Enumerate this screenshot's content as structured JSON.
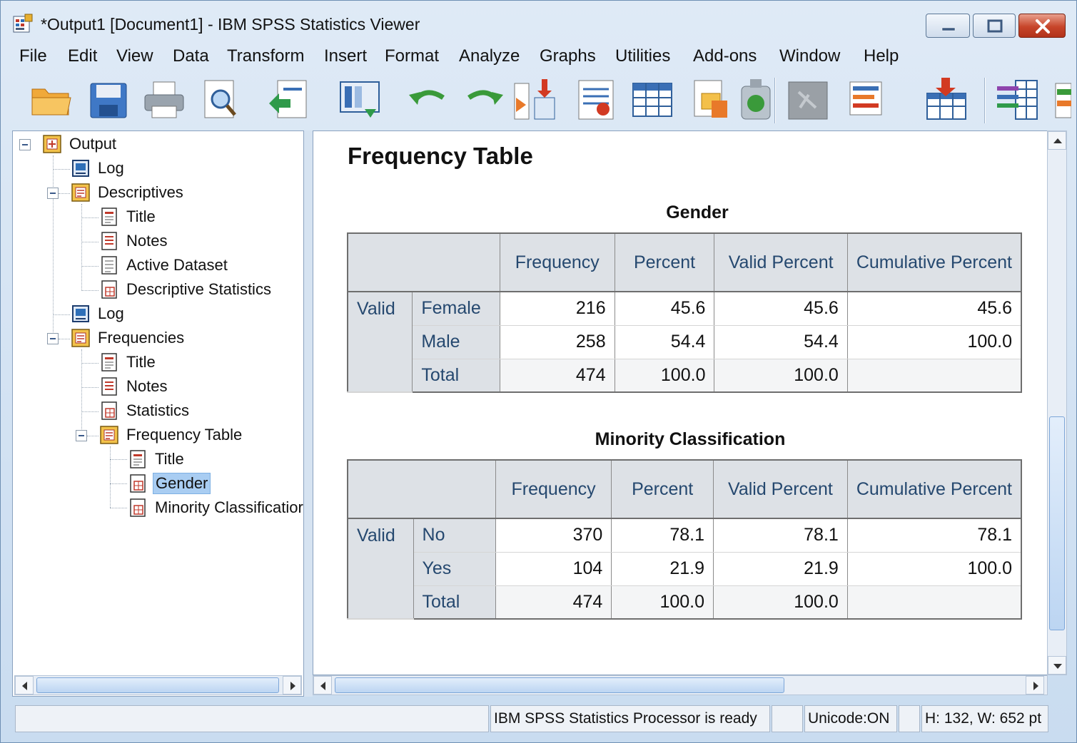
{
  "window": {
    "title": "*Output1 [Document1] - IBM SPSS Statistics Viewer"
  },
  "menu": {
    "items": [
      "File",
      "Edit",
      "View",
      "Data",
      "Transform",
      "Insert",
      "Format",
      "Analyze",
      "Graphs",
      "Utilities",
      "Add-ons",
      "Window",
      "Help"
    ]
  },
  "toolbar": {
    "icons": [
      "open-folder-icon",
      "save-icon",
      "print-icon",
      "print-preview-icon",
      "export-icon",
      "go-to-data-icon",
      "undo-icon",
      "redo-icon",
      "goto-case-icon",
      "insert-variable-icon",
      "find-icon",
      "data-table-icon",
      "designate-window-icon",
      "show-hide-icon",
      "syntax-icon",
      "insert-heading-icon",
      "import-data-icon",
      "variable-list-icon",
      "more-icon"
    ]
  },
  "tree": {
    "items": [
      {
        "label": "Output",
        "icon": "output-book-icon"
      },
      {
        "label": "Log",
        "icon": "log-icon"
      },
      {
        "label": "Descriptives",
        "icon": "procedure-book-icon"
      },
      {
        "label": "Title",
        "icon": "title-page-icon"
      },
      {
        "label": "Notes",
        "icon": "notes-page-icon"
      },
      {
        "label": "Active Dataset",
        "icon": "page-icon"
      },
      {
        "label": "Descriptive Statistics",
        "icon": "table-page-icon"
      },
      {
        "label": "Log",
        "icon": "log-icon"
      },
      {
        "label": "Frequencies",
        "icon": "procedure-book-icon"
      },
      {
        "label": "Title",
        "icon": "title-page-icon"
      },
      {
        "label": "Notes",
        "icon": "notes-page-icon"
      },
      {
        "label": "Statistics",
        "icon": "table-page-icon"
      },
      {
        "label": "Frequency Table",
        "icon": "procedure-book-icon"
      },
      {
        "label": "Title",
        "icon": "title-page-icon"
      },
      {
        "label": "Gender",
        "icon": "table-page-icon"
      },
      {
        "label": "Minority Classificatior",
        "icon": "table-page-icon"
      }
    ],
    "selected": "Gender"
  },
  "content": {
    "section_title": "Frequency Table",
    "columns": [
      "Frequency",
      "Percent",
      "Valid Percent",
      "Cumulative Percent"
    ],
    "tables": [
      {
        "caption": "Gender",
        "group_label": "Valid",
        "rows": [
          {
            "label": "Female",
            "frequency": "216",
            "percent": "45.6",
            "valid_percent": "45.6",
            "cumulative_percent": "45.6"
          },
          {
            "label": "Male",
            "frequency": "258",
            "percent": "54.4",
            "valid_percent": "54.4",
            "cumulative_percent": "100.0"
          },
          {
            "label": "Total",
            "frequency": "474",
            "percent": "100.0",
            "valid_percent": "100.0",
            "cumulative_percent": ""
          }
        ]
      },
      {
        "caption": "Minority Classification",
        "group_label": "Valid",
        "rows": [
          {
            "label": "No",
            "frequency": "370",
            "percent": "78.1",
            "valid_percent": "78.1",
            "cumulative_percent": "78.1"
          },
          {
            "label": "Yes",
            "frequency": "104",
            "percent": "21.9",
            "valid_percent": "21.9",
            "cumulative_percent": "100.0"
          },
          {
            "label": "Total",
            "frequency": "474",
            "percent": "100.0",
            "valid_percent": "100.0",
            "cumulative_percent": ""
          }
        ]
      }
    ]
  },
  "status": {
    "processor": "IBM SPSS Statistics Processor is ready",
    "unicode": "Unicode:ON",
    "dimensions": "H: 132, W: 652 pt"
  },
  "colors": {
    "header_bg": "#dde1e6",
    "header_text": "#25486f",
    "selection": "#a9cdf2",
    "close_button": "#c7452a"
  }
}
